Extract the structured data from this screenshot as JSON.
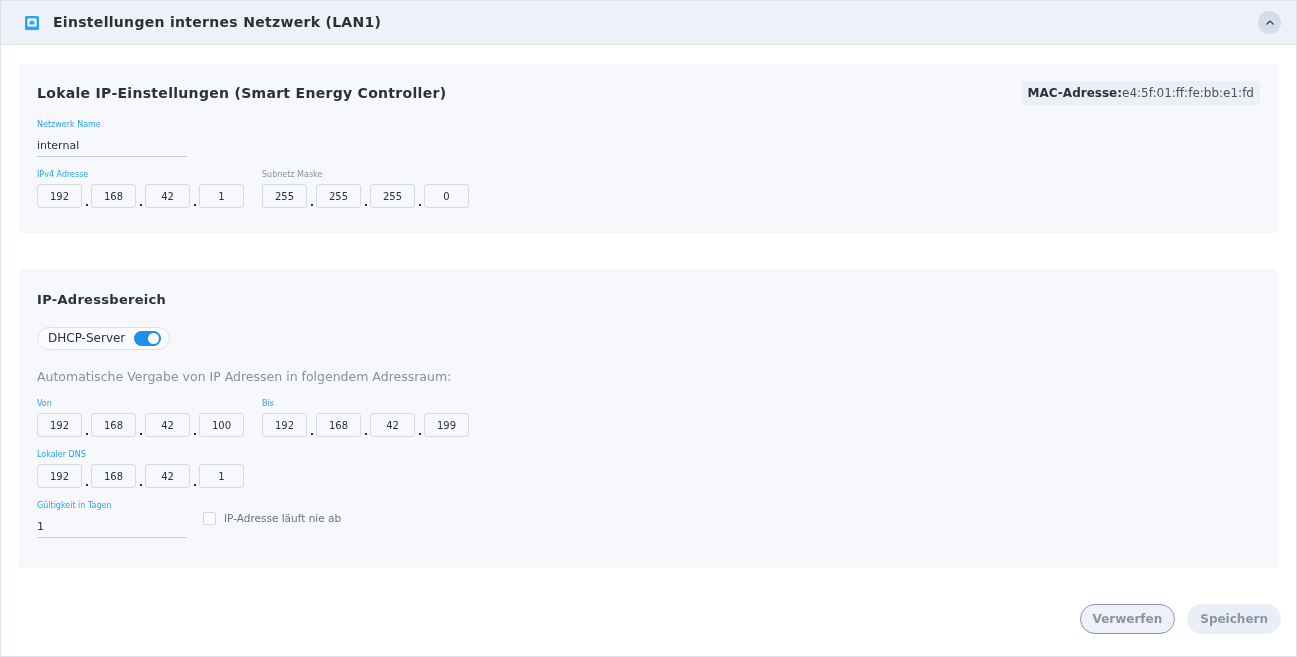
{
  "header": {
    "title": "Einstellungen internes Netzwerk (LAN1)",
    "expanded": true
  },
  "local": {
    "title": "Lokale IP-Einstellungen (Smart Energy Controller)",
    "mac": {
      "label": "MAC-Adresse:",
      "value": "e4:5f:01:ff:fe:bb:e1:fd"
    },
    "network_name": {
      "label": "Netzwerk Name",
      "value": "internal",
      "highlighted": true
    },
    "ip_rows": [
      [
        {
          "label": "IPv4 Adresse",
          "highlighted": true,
          "octets": [
            "192",
            "168",
            "42",
            "1"
          ]
        },
        {
          "label": "Subnetz Maske",
          "highlighted": false,
          "octets": [
            "255",
            "255",
            "255",
            "0"
          ]
        }
      ]
    ]
  },
  "range": {
    "title": "IP-Adressbereich",
    "dhcp": {
      "label": "DHCP-Server",
      "on": true
    },
    "description": "Automatische Vergabe von IP Adressen in folgendem Adressraum:",
    "ip_rows": [
      [
        {
          "label": "Von",
          "highlighted": true,
          "octets": [
            "192",
            "168",
            "42",
            "100"
          ]
        },
        {
          "label": "Bis",
          "highlighted": true,
          "octets": [
            "192",
            "168",
            "42",
            "199"
          ]
        }
      ],
      [
        {
          "label": "Lokaler DNS",
          "highlighted": true,
          "octets": [
            "192",
            "168",
            "42",
            "1"
          ]
        }
      ]
    ],
    "validity": {
      "label": "Gültigkeit in Tagen",
      "value": "1",
      "highlighted": true
    },
    "never_expires": {
      "label": "IP-Adresse läuft nie ab",
      "checked": false
    }
  },
  "buttons": [
    {
      "label": "Verwerfen",
      "kind": "outline"
    },
    {
      "label": "Speichern",
      "kind": "filled"
    }
  ]
}
